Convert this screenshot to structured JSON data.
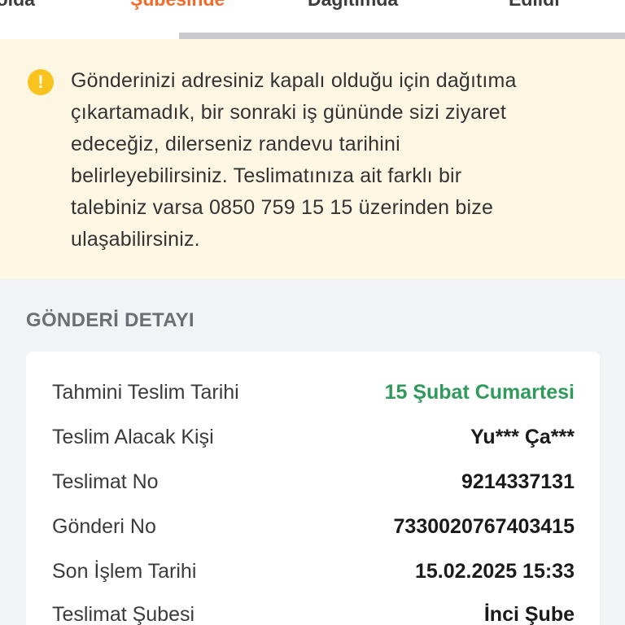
{
  "tabs": {
    "items": [
      {
        "label": "Yolda"
      },
      {
        "label": "Şubesinde"
      },
      {
        "label": "Dağıtımda"
      },
      {
        "label": "Edildi"
      }
    ]
  },
  "notice": {
    "icon": "warning-icon",
    "icon_glyph": "!",
    "icon_color": "#f8c31c",
    "lines": [
      "Gönderinizi adresiniz kapalı olduğu için dağıtıma",
      "çıkartamadık, bir sonraki iş gününde sizi ziyaret",
      "edeceğiz, dilerseniz randevu tarihini",
      "belirleyebilirsiniz. Teslimatınıza ait farklı bir",
      "talebiniz varsa 0850 759 15 15 üzerinden bize",
      "ulaşabilirsiniz."
    ]
  },
  "detail": {
    "section_title": "GÖNDERİ DETAYI",
    "rows": [
      {
        "label": "Tahmini Teslim Tarihi",
        "value": "15 Şubat Cumartesi"
      },
      {
        "label": "Teslim Alacak Kişi",
        "value": "Yu*** Ça***"
      },
      {
        "label": "Teslimat No",
        "value": "9214337131"
      },
      {
        "label": "Gönderi No",
        "value": "7330020767403415"
      },
      {
        "label": "Son İşlem Tarihi",
        "value": "15.02.2025 15:33"
      },
      {
        "label": "Teslimat Şubesi",
        "value": "İnci Şube"
      }
    ]
  },
  "colors": {
    "active_tab": "#f26b2a",
    "notice_bg": "#fdf6e3",
    "highlight_value": "#2f9a5b"
  }
}
